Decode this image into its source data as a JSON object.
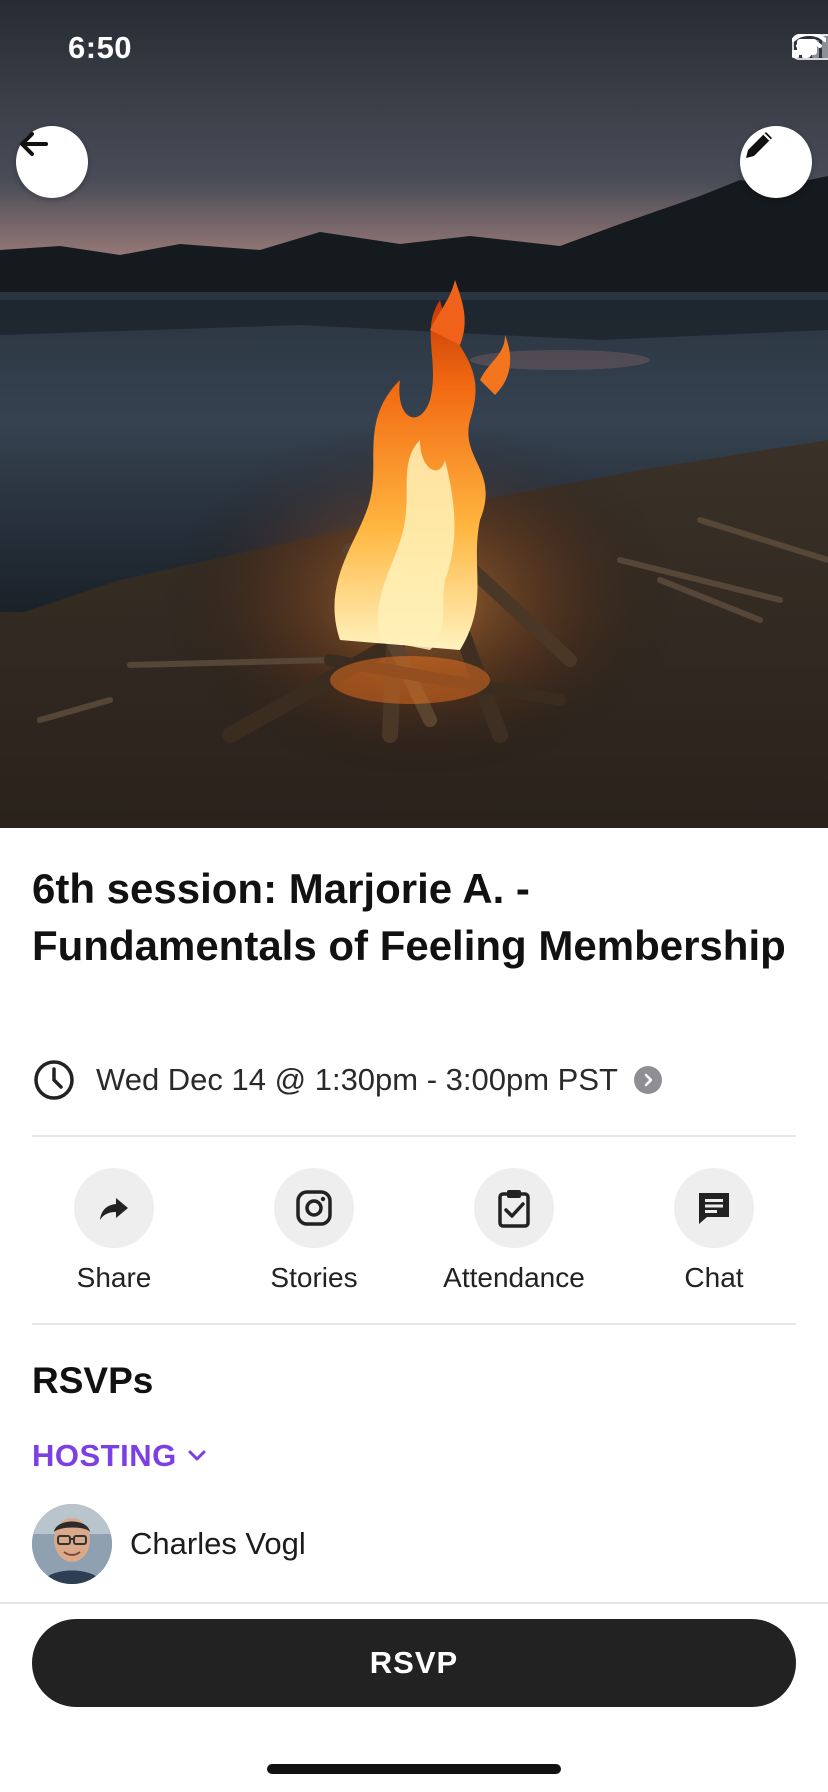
{
  "status_bar": {
    "time": "6:50"
  },
  "hero": {
    "image": "campfire-by-lake-photo"
  },
  "nav": {
    "back_icon": "arrow-left-icon",
    "edit_icon": "pencil-icon"
  },
  "event": {
    "title": "6th session: Marjorie A. - Fundamentals of Feeling Membership",
    "datetime": "Wed Dec 14 @ 1:30pm - 3:00pm PST"
  },
  "actions": [
    {
      "label": "Share",
      "icon": "share-arrow-icon"
    },
    {
      "label": "Stories",
      "icon": "instagram-icon"
    },
    {
      "label": "Attendance",
      "icon": "clipboard-check-icon"
    },
    {
      "label": "Chat",
      "icon": "chat-bubble-icon"
    }
  ],
  "rsvps": {
    "heading": "RSVPs",
    "filter_label": "HOSTING",
    "hosts": [
      {
        "name": "Charles Vogl"
      }
    ]
  },
  "footer": {
    "rsvp_label": "RSVP"
  },
  "colors": {
    "accent": "#7b3fe4",
    "button_dark": "#222222"
  }
}
